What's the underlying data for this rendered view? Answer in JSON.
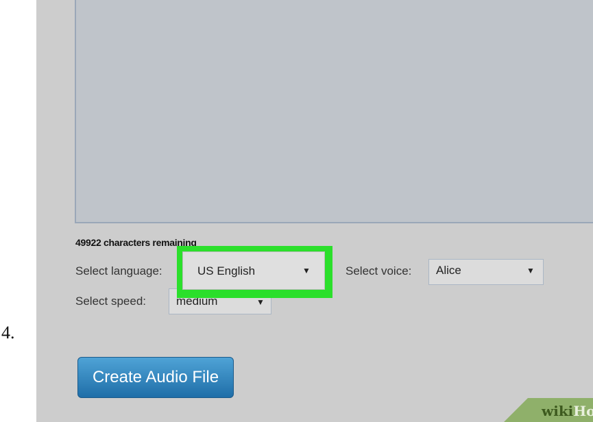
{
  "step": {
    "number": "4."
  },
  "form": {
    "chars_remaining": "49922 characters remaining",
    "language_label": "Select language:",
    "language_value": "US English",
    "voice_label": "Select voice:",
    "voice_value": "Alice",
    "speed_label": "Select speed:",
    "speed_value": "medium",
    "create_button": "Create Audio File"
  },
  "watermark": {
    "part1": "wiki",
    "part2": "How"
  },
  "colors": {
    "highlight": "#2bdf2b",
    "button": "#2a7fbf",
    "panel_bg": "#cdcdcd",
    "textarea_bg": "#bfc4ca"
  }
}
